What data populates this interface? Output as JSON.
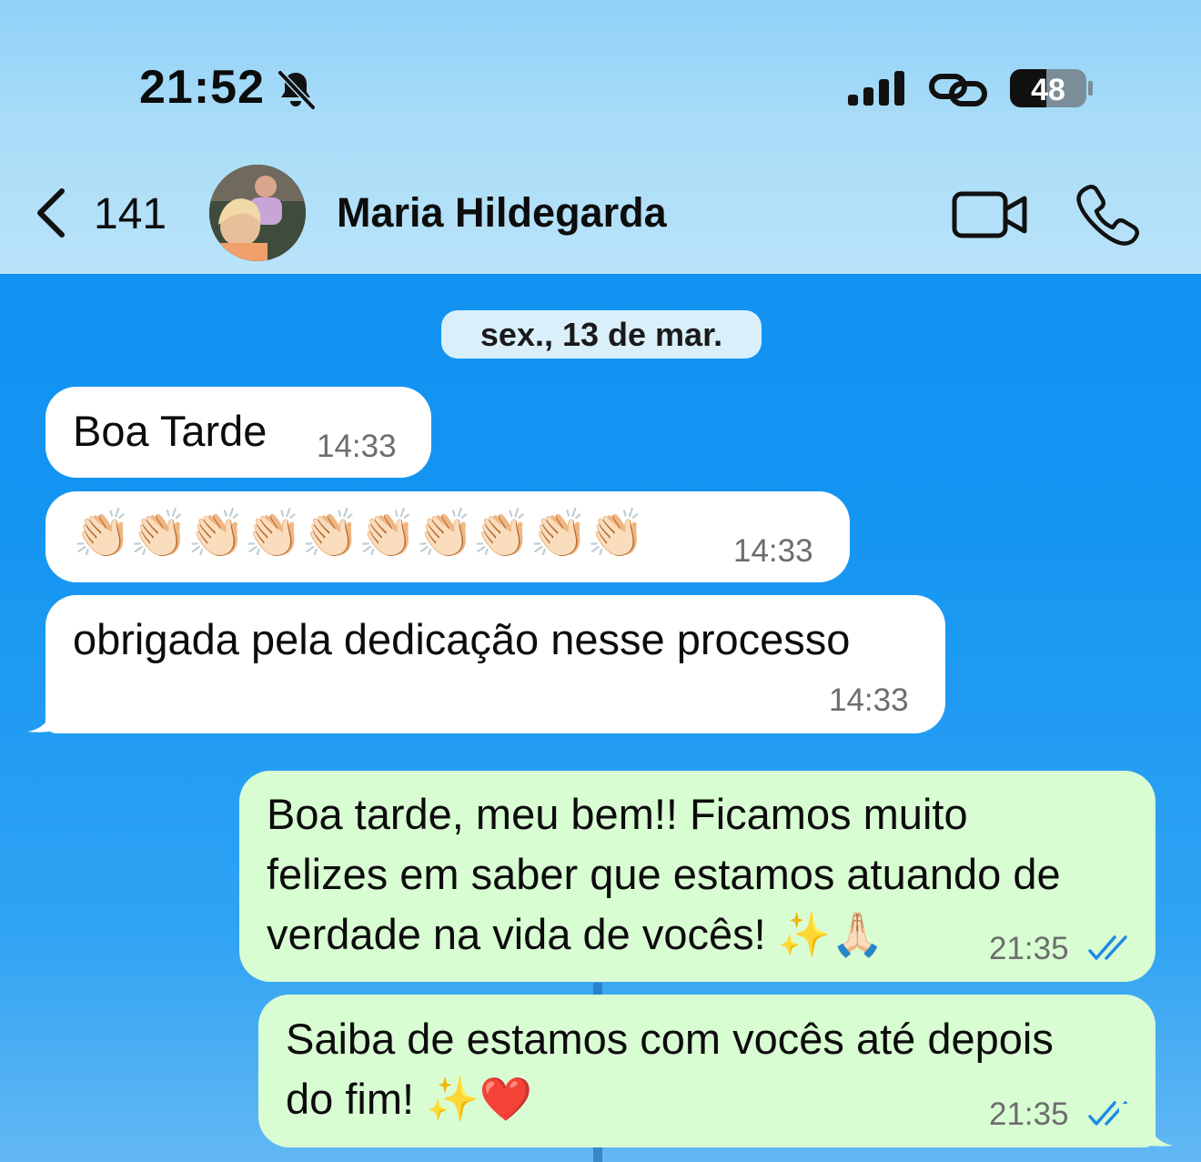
{
  "status": {
    "time": "21:52",
    "battery": "48"
  },
  "header": {
    "back_count": "141",
    "contact_name": "Maria Hildegarda"
  },
  "date_separator": "sex., 13 de mar.",
  "messages": [
    {
      "direction": "in",
      "text": "Boa Tarde",
      "time": "14:33"
    },
    {
      "direction": "in",
      "text": "👏🏻👏🏻👏🏻👏🏻👏🏻👏🏻👏🏻👏🏻👏🏻👏🏻",
      "time": "14:33"
    },
    {
      "direction": "in",
      "text": "obrigada pela dedicação nesse processo",
      "time": "14:33"
    },
    {
      "direction": "out",
      "lines": [
        "Boa tarde, meu bem!! Ficamos muito",
        "felizes em saber que estamos atuando de",
        "verdade na vida de vocês! ✨🙏🏻"
      ],
      "time": "21:35",
      "status": "read"
    },
    {
      "direction": "out",
      "lines": [
        "Saiba de estamos com vocês até depois",
        "do fim! ✨❤️"
      ],
      "time": "21:35",
      "status": "read"
    }
  ],
  "colors": {
    "incoming_bubble": "#ffffff",
    "outgoing_bubble": "#d9fdd3",
    "read_ticks": "#1e8be6",
    "chat_background": "#0e8ff0"
  },
  "icons": [
    "bell-muted-icon",
    "signal-bars-icon",
    "link-icon",
    "battery-icon",
    "back-chevron-icon",
    "video-call-icon",
    "phone-icon",
    "double-check-icon"
  ]
}
